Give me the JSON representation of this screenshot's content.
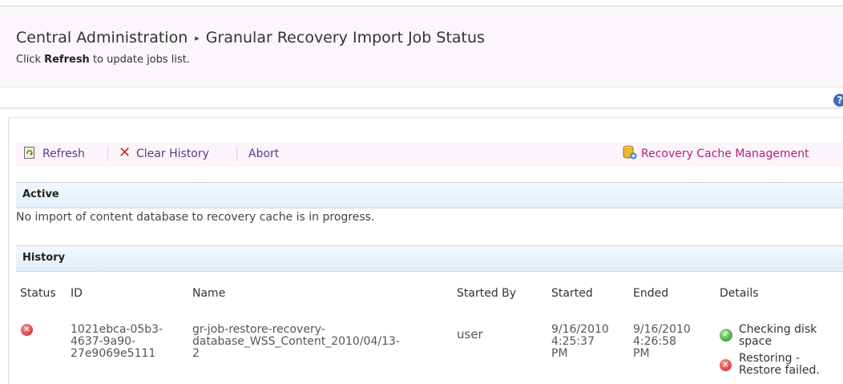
{
  "header": {
    "breadcrumb_root": "Central Administration",
    "breadcrumb_separator": "▸",
    "page_title": "Granular Recovery Import Job Status",
    "subtitle_prefix": "Click ",
    "subtitle_bold": "Refresh",
    "subtitle_suffix": " to update jobs list."
  },
  "help": {
    "icon": "help-icon",
    "glyph": "?"
  },
  "toolbar": {
    "refresh_label": "Refresh",
    "clear_history_label": "Clear History",
    "abort_label": "Abort",
    "recovery_cache_label": "Recovery Cache Management"
  },
  "sections": {
    "active_title": "Active",
    "active_empty_message": "No import of content database to recovery cache is in progress.",
    "history_title": "History"
  },
  "history_table": {
    "columns": [
      "Status",
      "ID",
      "Name",
      "Started By",
      "Started",
      "Ended",
      "Details"
    ],
    "rows": [
      {
        "status": "error",
        "id_lines": [
          "1021ebca-05b3-",
          "4637-9a90-",
          "27e9069e5111"
        ],
        "name_lines": [
          "gr-job-restore-recovery-",
          "database_WSS_Content_2010/04/13-",
          "2"
        ],
        "started_by": "user",
        "started_lines": [
          "9/16/2010",
          "4:25:37",
          "PM"
        ],
        "ended_lines": [
          "9/16/2010",
          "4:26:58",
          "PM"
        ],
        "details": [
          {
            "status": "success",
            "lines": [
              "Checking disk",
              "space"
            ]
          },
          {
            "status": "error",
            "lines": [
              "Restoring -",
              "Restore failed."
            ]
          }
        ]
      }
    ]
  },
  "colors": {
    "link_purple": "#5a3d8a",
    "error_red": "#d83a3a",
    "success_green": "#3da43a",
    "section_blue": "#e3eef8"
  }
}
